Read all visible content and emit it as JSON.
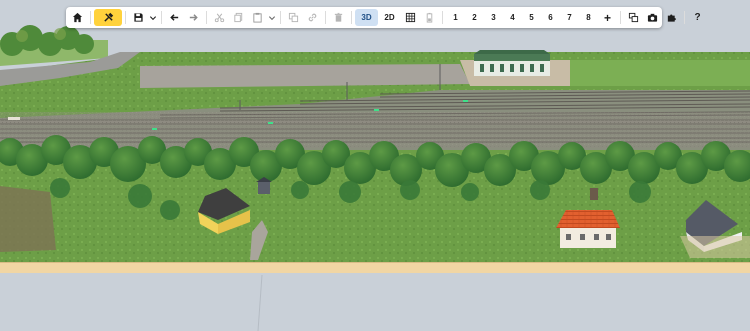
{
  "app": {
    "view_mode": "3D"
  },
  "toolbar": {
    "view_3d_label": "3D",
    "view_2d_label": "2D",
    "layers": [
      "1",
      "2",
      "3",
      "4",
      "5",
      "6",
      "7",
      "8"
    ],
    "add_layer_label": "+",
    "help_label": "?"
  },
  "colors": {
    "active_tool": "#ffd23c",
    "active_view": "#cfe0f3",
    "grass": "#6fa24a",
    "baseboard": "#f1d6a4"
  },
  "icons": [
    "home-icon",
    "tools-icon",
    "save-icon",
    "chevron-down-icon",
    "undo-icon",
    "redo-icon",
    "cut-icon",
    "copy-icon",
    "paste-icon",
    "duplicate-icon",
    "link-icon",
    "delete-icon",
    "grid-icon",
    "battery-icon",
    "add-icon",
    "windows-icon",
    "camera-icon",
    "puzzle-icon",
    "help-icon"
  ]
}
